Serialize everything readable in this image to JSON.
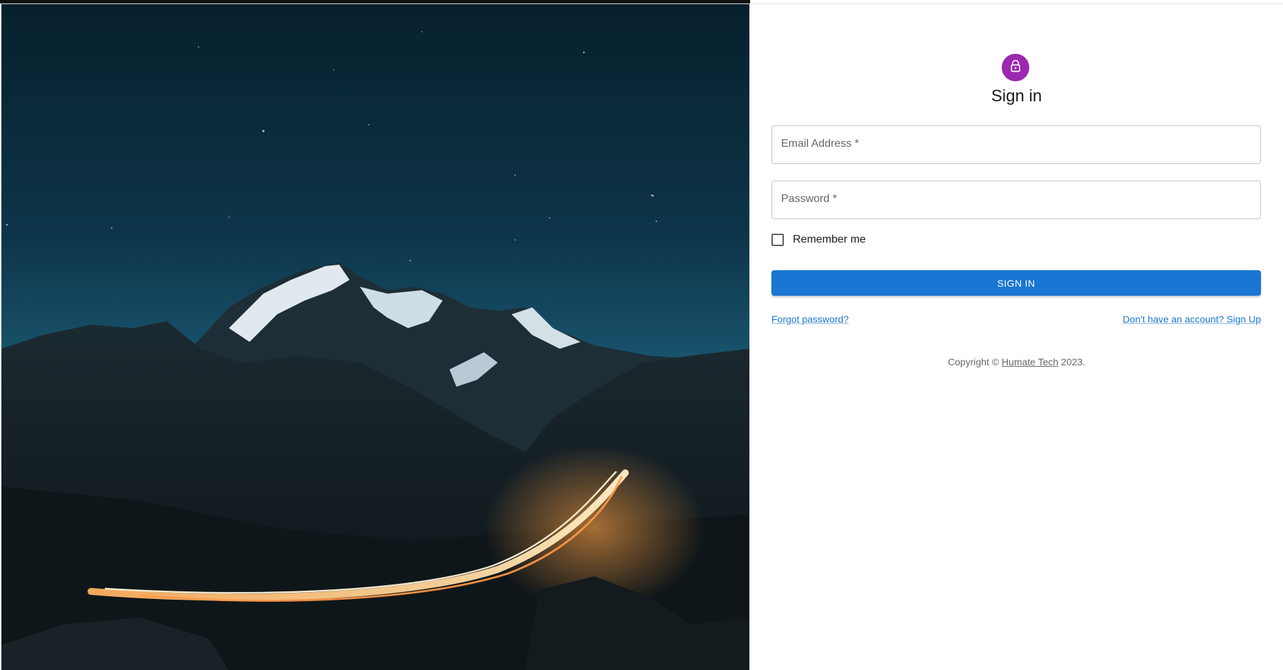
{
  "hero": {
    "image_description_icon": "mountain-night-landscape"
  },
  "form": {
    "icon": "lock-icon",
    "avatar_color": "#9c27b0",
    "title": "Sign in",
    "email_label": "Email Address *",
    "email_value": "",
    "password_label": "Password *",
    "password_value": "",
    "remember_label": "Remember me",
    "remember_checked": false,
    "submit_label": "SIGN IN",
    "primary_color": "#1976d2",
    "forgot_link": "Forgot password?",
    "signup_link": "Don't have an account? Sign Up"
  },
  "footer": {
    "prefix": "Copyright © ",
    "company": "Humate Tech",
    "suffix": " 2023."
  }
}
